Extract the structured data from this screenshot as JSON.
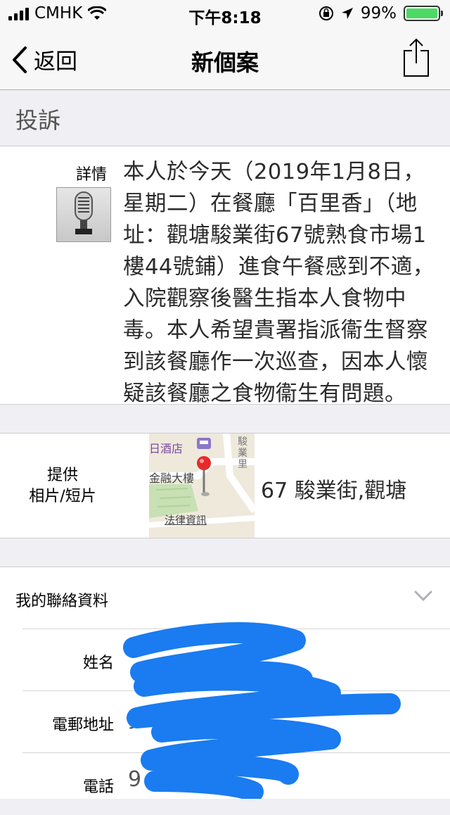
{
  "status_bar": {
    "carrier": "CMHK",
    "time": "下午8:18",
    "battery_percent": "99%",
    "battery_level": 0.99,
    "icons": [
      "signal-icon",
      "wifi-icon",
      "orientation-lock-icon",
      "location-arrow-icon",
      "battery-icon"
    ]
  },
  "nav": {
    "back_label": "返回",
    "title": "新個案",
    "share_icon": "share-icon"
  },
  "section": {
    "title": "投訴"
  },
  "details": {
    "label": "詳情",
    "text": "本人於今天（2019年1月8日，星期二）在餐廳「百里香」（地址：觀塘駿業街67號熟食市場1樓44號鋪）進食午餐感到不適，入院觀察後醫生指本人食物中毒。本人希望貴署指派衞生督察到該餐廳作一次巡查，因本人懷疑該餐廳之食物衞生有問題。"
  },
  "media": {
    "label_line1": "提供",
    "label_line2": "相片/短片",
    "map": {
      "hotel_label": "日酒店",
      "building_label": "金融大樓",
      "street_label": "駿業里",
      "legal_label": "法律資訊"
    },
    "address": "67 駿業街,觀塘"
  },
  "contact": {
    "header": "我的聯絡資料",
    "rows": [
      {
        "label": "姓名",
        "value": ""
      },
      {
        "label": "電郵地址",
        "value": "y                        .com"
      },
      {
        "label": "電話",
        "value": "9"
      }
    ]
  },
  "colors": {
    "accent": "#0077ff",
    "battery": "#4cd964",
    "map_pin": "#e52b2b"
  }
}
